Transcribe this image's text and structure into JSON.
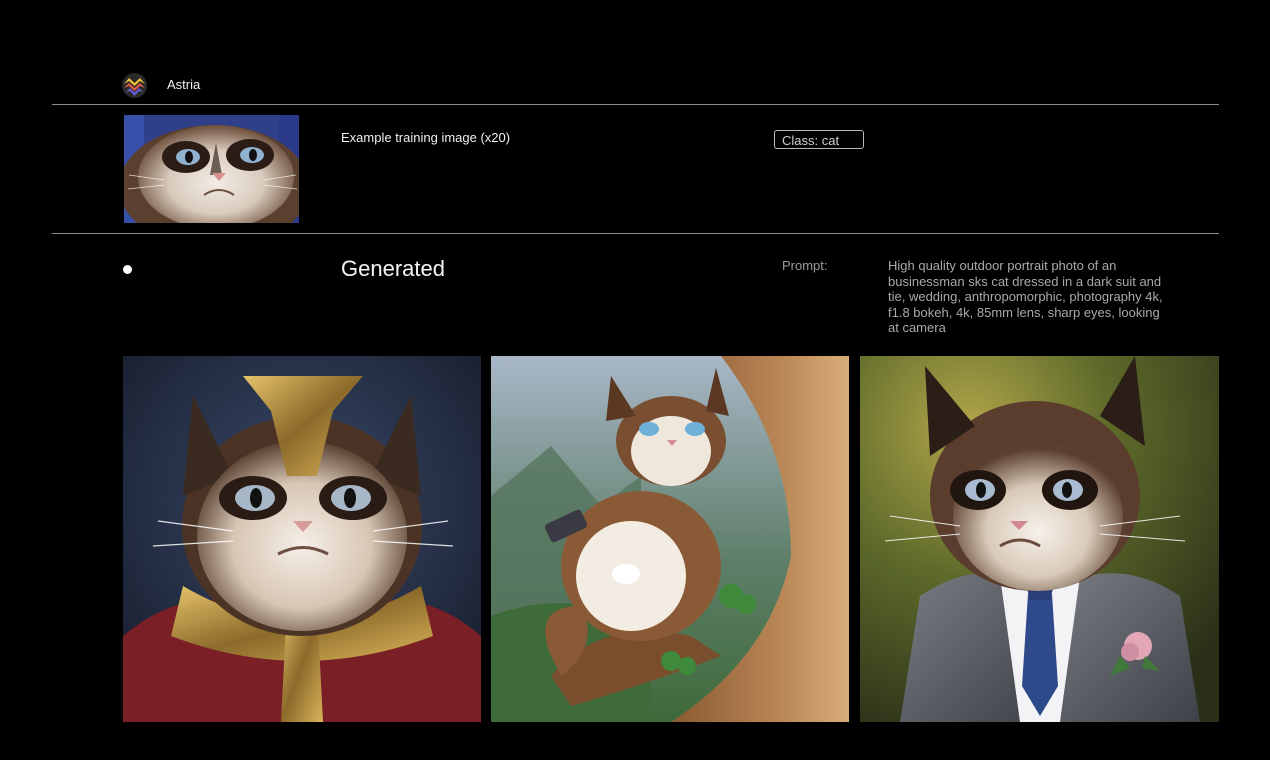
{
  "app": {
    "brand": "Astria",
    "logo_icon": "astria-logo-icon"
  },
  "training": {
    "label": "Example training image (x20)",
    "class_label": "Class: cat",
    "image_description": "grumpy-cat-photo"
  },
  "generated": {
    "title": "Generated",
    "prompt_label": "Prompt:",
    "prompt_text": "High quality outdoor portrait photo of an businessman sks cat dressed in a dark suit and tie, wedding, anthropomorphic, photography 4k, f1.8 bokeh, 4k, 85mm lens, sharp eyes, looking at camera",
    "images": [
      {
        "name": "generated-image-armored-cat"
      },
      {
        "name": "generated-image-cat-on-tree"
      },
      {
        "name": "generated-image-cat-in-suit"
      }
    ]
  },
  "colors": {
    "background": "#000000",
    "rule": "#8e8e8e",
    "text_primary": "#f0f0f0",
    "text_muted": "#a9a9a9"
  }
}
